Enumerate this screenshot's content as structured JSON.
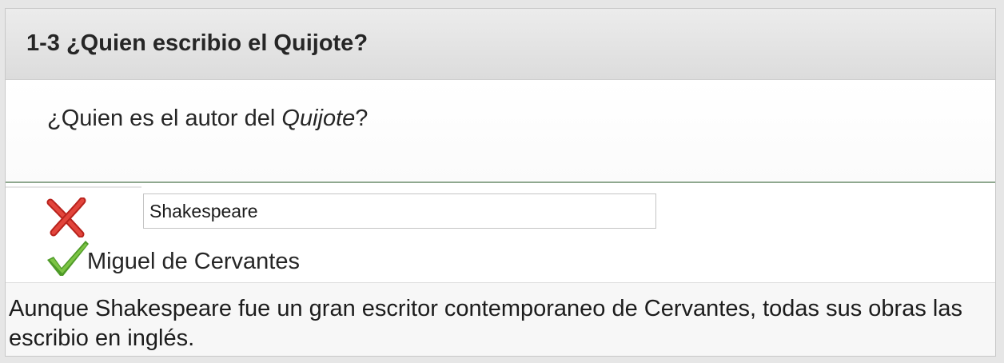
{
  "question": {
    "title": "1-3 ¿Quien escribio el Quijote?",
    "prompt_before": "¿Quien es el autor del ",
    "prompt_italic": "Quijote",
    "prompt_after": "?"
  },
  "answer": {
    "user_value": "Shakespeare",
    "user_result_icon": "incorrect-x-icon",
    "correct_icon": "correct-checkmark-icon",
    "correct_value": "Miguel de Cervantes"
  },
  "feedback": {
    "text": "Aunque Shakespeare fue un gran escritor contemporaneo de Cervantes, todas sus obras las escribio en inglés."
  },
  "colors": {
    "incorrect": "#d8322a",
    "correct": "#5bab2e",
    "divider": "#8fa88f"
  }
}
